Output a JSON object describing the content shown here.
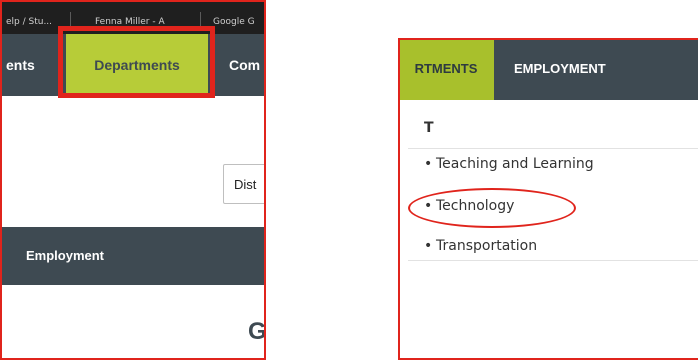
{
  "left": {
    "browser_tabs": [
      "elp / Stu...",
      "Fenna Miller - A",
      "Google G"
    ],
    "nav": {
      "partial_left": "ents",
      "departments": "Departments",
      "partial_right": "Com"
    },
    "district_select": "Dist",
    "sub_nav_label": "Employment",
    "heading_partial": "G"
  },
  "right": {
    "nav": {
      "departments": "RTMENTS",
      "employment": "EMPLOYMENT"
    },
    "letter": "T",
    "items": [
      {
        "label": "Teaching and Learning"
      },
      {
        "label": "Technology"
      },
      {
        "label": "Transportation"
      }
    ],
    "bullet": "•"
  },
  "colors": {
    "nav_bg": "#3e4a52",
    "accent_green": "#b7cc38",
    "annotation_red": "#e0241c"
  }
}
